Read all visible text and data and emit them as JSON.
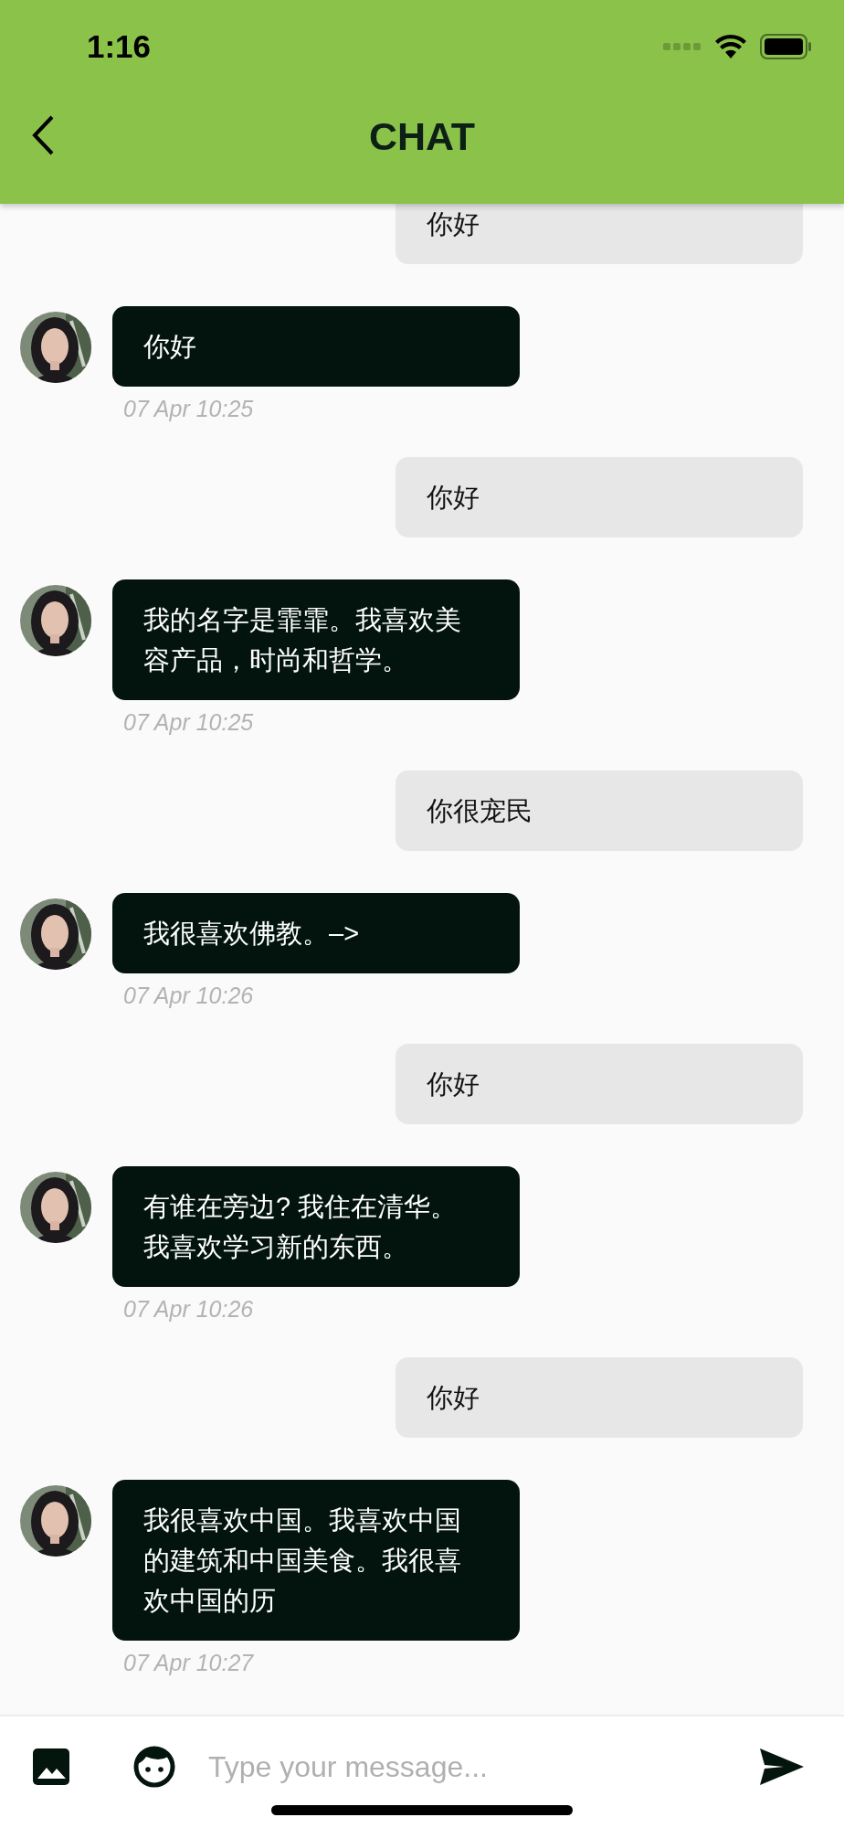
{
  "status_bar": {
    "time": "1:16"
  },
  "header": {
    "title": "CHAT"
  },
  "messages": [
    {
      "kind": "sent",
      "text": "你好"
    },
    {
      "kind": "received",
      "text": "你好",
      "time": "07 Apr 10:25"
    },
    {
      "kind": "sent",
      "text": "你好"
    },
    {
      "kind": "received",
      "text": "我的名字是霏霏。我喜欢美容产品，时尚和哲学。",
      "time": "07 Apr 10:25"
    },
    {
      "kind": "sent",
      "text": "你很宠民"
    },
    {
      "kind": "received",
      "text": "我很喜欢佛教。–>",
      "time": "07 Apr 10:26"
    },
    {
      "kind": "sent",
      "text": "你好"
    },
    {
      "kind": "received",
      "text": "有谁在旁边? 我住在清华。我喜欢学习新的东西。",
      "time": "07 Apr 10:26"
    },
    {
      "kind": "sent",
      "text": "你好"
    },
    {
      "kind": "received",
      "text": "我很喜欢中国。我喜欢中国的建筑和中国美食。我很喜欢中国的历",
      "time": "07 Apr 10:27"
    }
  ],
  "composer": {
    "placeholder": "Type your message..."
  }
}
